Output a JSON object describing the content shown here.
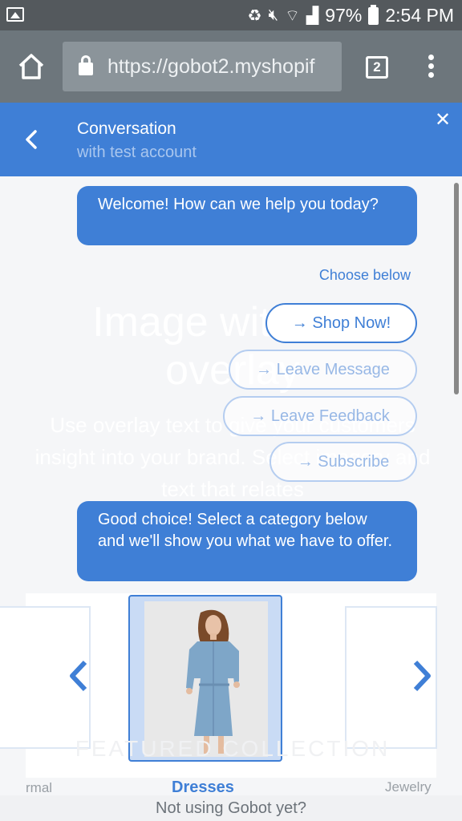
{
  "status_bar": {
    "battery": "97%",
    "time": "2:54 PM"
  },
  "browser": {
    "url": "https://gobot2.myshopif",
    "tab_count": "2"
  },
  "chat_header": {
    "title": "Conversation",
    "subtitle": "with test account"
  },
  "background": {
    "heading": "Image with text overlay",
    "paragraph": "Use overlay text to give your customers insight into your brand. Select imagery and text that relates",
    "featured": "FEATURED COLLECTION"
  },
  "messages": [
    {
      "text": "Welcome! How can we help you today?"
    },
    {
      "text": "Good choice! Select a category below and we'll show you what we have to offer."
    }
  ],
  "choose_label": "Choose below",
  "options": [
    {
      "label": "→ Shop Now!"
    },
    {
      "label": "→ Leave Message"
    },
    {
      "label": "→ Leave Feedback"
    },
    {
      "label": "→ Subscribe"
    }
  ],
  "carousel": {
    "left_category": "rmal",
    "current_category": "Dresses",
    "right_category": "Jewelry"
  },
  "footer": "Not using Gobot yet?",
  "colors": {
    "accent": "#3f7fd6",
    "status_bar": "#54595d",
    "browser_bar": "#6d767c"
  }
}
